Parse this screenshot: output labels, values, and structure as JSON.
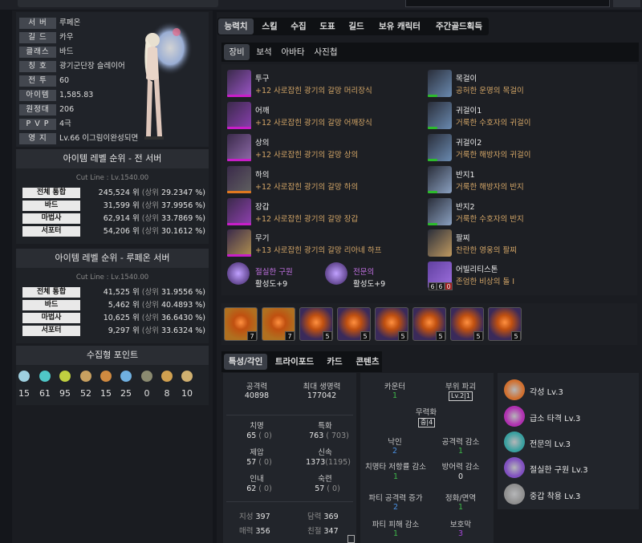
{
  "profile": {
    "rows": [
      {
        "label": "서 버",
        "value": "루페온"
      },
      {
        "label": "길 드",
        "value": "카우"
      },
      {
        "label": "클래스",
        "value": "바드"
      },
      {
        "label": "칭 호",
        "value": "광기군단장 슬레이어"
      },
      {
        "label": "전 투",
        "value": "60"
      },
      {
        "label": "아이템",
        "value": "1,585.83"
      },
      {
        "label": "원정대",
        "value": "206"
      },
      {
        "label": "P V P",
        "value": "4극"
      },
      {
        "label": "영 지",
        "value": "Lv.66 이그림이완성되면"
      }
    ]
  },
  "ranking_all": {
    "title": "아이템 레벨 순위 - 전 서버",
    "cutline": "Cut Line : Lv.1540.00",
    "rows": [
      {
        "label": "전체 통합",
        "value": "245,524 위",
        "sub": "(상위",
        "pct": "29.2347 %)"
      },
      {
        "label": "바드",
        "value": "31,599 위",
        "sub": "(상위",
        "pct": "37.9956 %)"
      },
      {
        "label": "마법사",
        "value": "62,914 위",
        "sub": "(상위",
        "pct": "33.7869 %)"
      },
      {
        "label": "서포터",
        "value": "54,206 위",
        "sub": "(상위",
        "pct": "30.1612 %)"
      }
    ]
  },
  "ranking_server": {
    "title": "아이템 레벨 순위 - 루페온 서버",
    "cutline": "Cut Line : Lv.1540.00",
    "rows": [
      {
        "label": "전체 통합",
        "value": "41,525 위",
        "sub": "(상위",
        "pct": "31.9556 %)"
      },
      {
        "label": "바드",
        "value": "5,462 위",
        "sub": "(상위",
        "pct": "40.4893 %)"
      },
      {
        "label": "마법사",
        "value": "10,625 위",
        "sub": "(상위",
        "pct": "36.6430 %)"
      },
      {
        "label": "서포터",
        "value": "9,297 위",
        "sub": "(상위",
        "pct": "33.6324 %)"
      }
    ]
  },
  "collection": {
    "title": "수집형 포인트",
    "items": [
      {
        "icon": "island-soul-icon",
        "value": "15",
        "color": "#9fd0e0"
      },
      {
        "icon": "giant-heart-icon",
        "value": "61",
        "color": "#4fc7c7"
      },
      {
        "icon": "seed-icon",
        "value": "95",
        "color": "#c0d040"
      },
      {
        "icon": "art-icon",
        "value": "52",
        "color": "#c8a060"
      },
      {
        "icon": "voyage-icon",
        "value": "15",
        "color": "#d08a40"
      },
      {
        "icon": "star-icon",
        "value": "25",
        "color": "#70b0e0"
      },
      {
        "icon": "world-tree-icon",
        "value": "0",
        "color": "#8a8a70"
      },
      {
        "icon": "ignea-icon",
        "value": "8",
        "color": "#d0a050"
      },
      {
        "icon": "orpheus-icon",
        "value": "10",
        "color": "#d0b070"
      }
    ]
  },
  "tabs": [
    "능력치",
    "스킬",
    "수집",
    "도표",
    "길드",
    "보유 캐릭터",
    "주간골드획득"
  ],
  "subtabs": [
    "장비",
    "보석",
    "아바타",
    "사진첩"
  ],
  "equipment_left": [
    {
      "name": "투구",
      "desc": "+12 사로잡힌 광기의 갈망 머리장식",
      "bar": "#c81ec8",
      "color": "#9c55c8"
    },
    {
      "name": "어깨",
      "desc": "+12 사로잡힌 광기의 갈망 어깨장식",
      "bar": "#c81ec8",
      "color": "#8a3fb0"
    },
    {
      "name": "상의",
      "desc": "+12 사로잡힌 광기의 갈망 상의",
      "bar": "#c81ec8",
      "color": "#8e6aa8"
    },
    {
      "name": "하의",
      "desc": "+12 사로잡힌 광기의 갈망 하의",
      "bar": "#e07820",
      "color": "#606060"
    },
    {
      "name": "장갑",
      "desc": "+12 사로잡힌 광기의 갈망 장갑",
      "bar": "#c81ec8",
      "color": "#9040b0"
    },
    {
      "name": "무기",
      "desc": "+13 사로잡힌 광기의 갈망 리아네 하프",
      "bar": "#c81ec8",
      "color": "#b09050"
    }
  ],
  "equipment_right": [
    {
      "name": "목걸이",
      "desc": "공허한 운명의 목걸이",
      "bar": "#2dbb2d",
      "color": "#6a8ab0"
    },
    {
      "name": "귀걸이1",
      "desc": "거룩한 수호자의 귀걸이",
      "bar": "#2dbb2d",
      "color": "#6a8ab0"
    },
    {
      "name": "귀걸이2",
      "desc": "거룩한 해방자의 귀걸이",
      "bar": "#2dbb2d",
      "color": "#6a8ab0"
    },
    {
      "name": "반지1",
      "desc": "거룩한 해방자의 반지",
      "bar": "#2dbb2d",
      "color": "#8aa0c0"
    },
    {
      "name": "반지2",
      "desc": "거룩한 수호자의 반지",
      "bar": "#2dbb2d",
      "color": "#8aa0c0"
    },
    {
      "name": "팔찌",
      "desc": "찬란한 영웅의 팔찌",
      "bar": "",
      "color": "#c09a60"
    }
  ],
  "specials": [
    {
      "name": "절실한 구원",
      "value": "활성도+9",
      "namecolor": "#c070e0"
    },
    {
      "name": "전문의",
      "value": "활성도+9",
      "namecolor": "#c070e0"
    }
  ],
  "stone": {
    "name": "어빌리티스톤",
    "desc": "존엄한 비상의 돌 I",
    "n1": "6",
    "n2": "6",
    "n3": "0"
  },
  "gems": [
    "7",
    "7",
    "5",
    "5",
    "5",
    "5",
    "5",
    "5"
  ],
  "bottom_tabs": [
    "특성/각인",
    "트라이포드",
    "카드",
    "콘텐츠"
  ],
  "stats": {
    "atk_label": "공격력",
    "atk": "40898",
    "hp_label": "최대 생명력",
    "hp": "177042",
    "crit_label": "치명",
    "crit": "65",
    "crit_b": "0",
    "spec_label": "특화",
    "spec": "763",
    "spec_b": "703",
    "dom_label": "제압",
    "dom": "57",
    "dom_b": "0",
    "swift_label": "신속",
    "swift": "1373",
    "swift_b": "1195",
    "end_label": "인내",
    "end": "62",
    "end_b": "0",
    "exp_label": "숙련",
    "exp": "57",
    "exp_b": "0",
    "int_label": "지성",
    "int": "397",
    "bold_label": "담력",
    "bold": "369",
    "cha_label": "매력",
    "cha": "356",
    "kind_label": "친절",
    "kind": "347"
  },
  "combat": {
    "counter_label": "카운터",
    "counter": "1",
    "part_label": "부위 파괴",
    "part": "Lv.2",
    "part2": "1",
    "stagger_label": "무력화",
    "stagger": "중",
    "stagger2": "4",
    "brand_label": "낙인",
    "brand": "2",
    "atkdown_label": "공격력 감소",
    "atkdown": "1",
    "critres_label": "치명타 저항률 감소",
    "critres": "1",
    "defdown_label": "방어력 감소",
    "defdown": "0",
    "partyatk_label": "파티 공격력 증가",
    "partyatk": "2",
    "purify_label": "정화/면역",
    "purify": "1",
    "partydmg_label": "파티 피해 감소",
    "partydmg": "1",
    "shield_label": "보호막",
    "shield": "3"
  },
  "engravings": [
    {
      "name": "각성 Lv.3",
      "color": "#d07030"
    },
    {
      "name": "급소 타격 Lv.3",
      "color": "#b030b0"
    },
    {
      "name": "전문의 Lv.3",
      "color": "#3aa0a0"
    },
    {
      "name": "절실한 구원 Lv.3",
      "color": "#8050c0"
    },
    {
      "name": "중갑 착용 Lv.3",
      "color": "#909090"
    }
  ]
}
